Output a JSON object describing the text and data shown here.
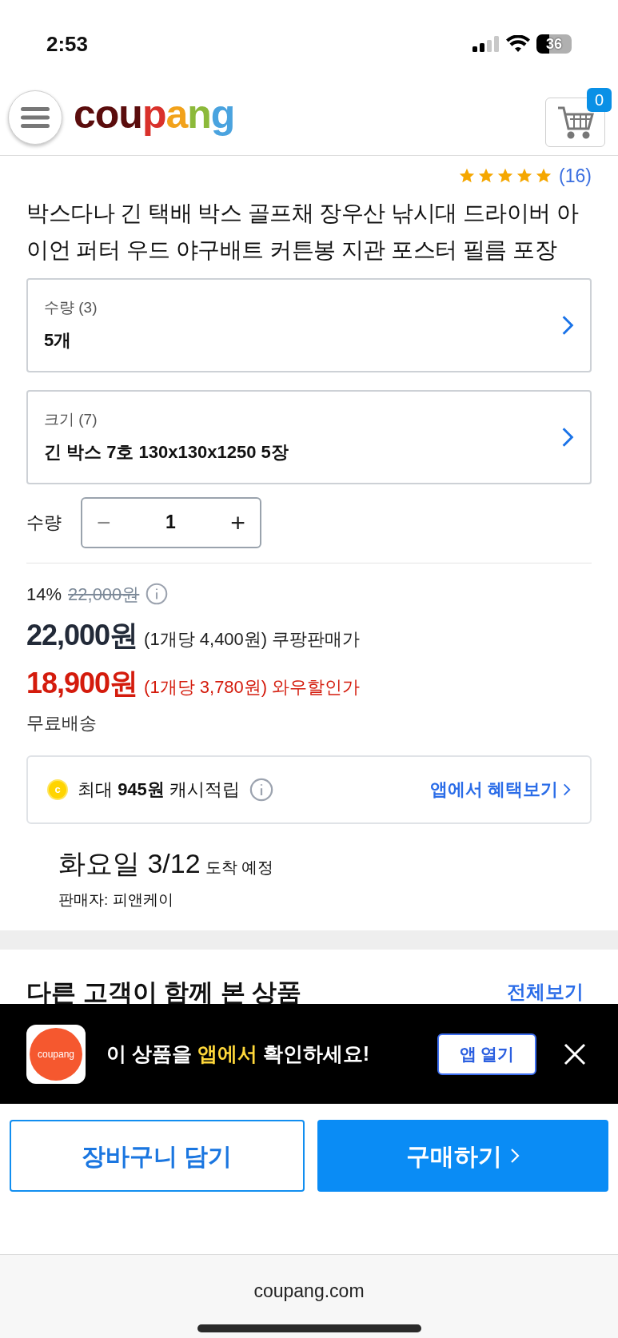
{
  "status_bar": {
    "time": "2:53",
    "battery": "36"
  },
  "header": {
    "logo": "coupang",
    "cart_count": "0"
  },
  "rating": {
    "stars": 5,
    "count": "(16)"
  },
  "product_title": "박스다나 긴 택배 박스 골프채 장우산 낚시대 드라이버 아이언 퍼터 우드 야구배트 커튼봉 지관 포스터 필름 포장",
  "options": [
    {
      "label": "수량 (3)",
      "value": "5개"
    },
    {
      "label": "크기 (7)",
      "value": "긴 박스 7호 130x130x1250 5장"
    }
  ],
  "quantity": {
    "label": "수량",
    "minus": "−",
    "value": "1",
    "plus": "+"
  },
  "price": {
    "discount": "14%",
    "original": "22,000원",
    "sale": "22,000원",
    "sale_unit": "(1개당 4,400원) 쿠팡판매가",
    "wow": "18,900원",
    "wow_unit": "(1개당 3,780원) 와우할인가",
    "shipping": "무료배송"
  },
  "cashback": {
    "coin": "c",
    "prefix": "최대",
    "amount": "945원",
    "suffix": "캐시적립",
    "link": "앱에서 혜택보기"
  },
  "delivery": {
    "date": "화요일 3/12",
    "note": "도착 예정",
    "seller": "판매자: 피앤케이"
  },
  "related": {
    "title": "다른 고객이 함께 본 상품",
    "link": "전체보기"
  },
  "app_banner": {
    "icon_text": "coupang",
    "before": "이 상품을 ",
    "highlight": "앱에서",
    "after": " 확인하세요!",
    "button": "앱 열기"
  },
  "actions": {
    "cart": "장바구니 담기",
    "buy": "구매하기"
  },
  "browser": {
    "url": "coupang.com"
  }
}
